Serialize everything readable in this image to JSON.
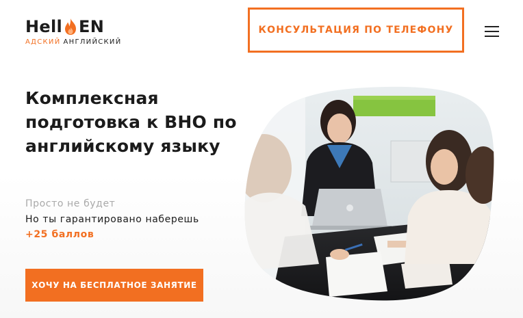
{
  "brand": {
    "logo_left": "Hell",
    "logo_right": "EN",
    "tagline_accent": "АДСКИЙ",
    "tagline_rest": "АНГЛИЙСКИЙ"
  },
  "header": {
    "consult_label": "КОНСУЛЬТАЦИЯ ПО ТЕЛЕФОНУ"
  },
  "hero": {
    "title": "Комплексная подготовка к ВНО по английскому языку",
    "line1": "Просто не будет",
    "line2": "Но ты гарантировано наберешь",
    "line3": "+25 баллов",
    "cta_label": "ХОЧУ НА БЕСПЛАТНОЕ ЗАНЯТИЕ"
  },
  "colors": {
    "accent": "#f26f21",
    "text": "#1b1b1b",
    "muted": "#a9a9a9"
  },
  "icons": {
    "logo_flame": "flame-icon",
    "menu": "hamburger-menu-icon"
  }
}
